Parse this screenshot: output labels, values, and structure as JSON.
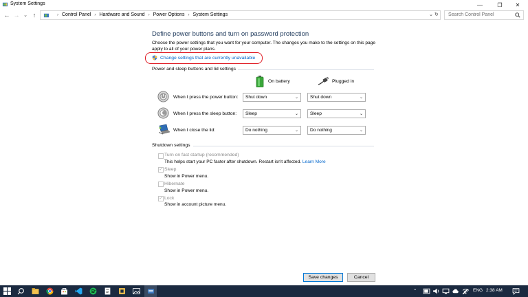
{
  "window": {
    "title": "System Settings",
    "minimize_glyph": "—",
    "restore_glyph": "❐",
    "close_glyph": "✕"
  },
  "nav": {
    "back_glyph": "←",
    "forward_glyph": "→",
    "recent_glyph": "⌄",
    "up_glyph": "↑",
    "breadcrumbs": [
      "Control Panel",
      "Hardware and Sound",
      "Power Options",
      "System Settings"
    ],
    "breadcrumb_separator": "›",
    "dropdown_glyph": "⌄",
    "refresh_glyph": "↻",
    "search_placeholder": "Search Control Panel"
  },
  "page": {
    "heading": "Define power buttons and turn on password protection",
    "description": "Choose the power settings that you want for your computer. The changes you make to the settings on this page apply to all of your power plans.",
    "change_link": "Change settings that are currently unavailable"
  },
  "power_section": {
    "title": "Power and sleep buttons and lid settings",
    "col_battery": "On battery",
    "col_plugged": "Plugged in",
    "rows": [
      {
        "label": "When I press the power button:",
        "battery": "Shut down",
        "plugged": "Shut down"
      },
      {
        "label": "When I press the sleep button:",
        "battery": "Sleep",
        "plugged": "Sleep"
      },
      {
        "label": "When I close the lid:",
        "battery": "Do nothing",
        "plugged": "Do nothing"
      }
    ],
    "caret": "⌄"
  },
  "shutdown_section": {
    "title": "Shutdown settings",
    "items": [
      {
        "label": "Turn on fast startup (recommended)",
        "checked": false,
        "sub": "This helps start your PC faster after shutdown. Restart isn't affected.",
        "link": "Learn More"
      },
      {
        "label": "Sleep",
        "checked": true,
        "sub": "Show in Power menu."
      },
      {
        "label": "Hibernate",
        "checked": false,
        "sub": "Show in Power menu."
      },
      {
        "label": "Lock",
        "checked": true,
        "sub": "Show in account picture menu."
      }
    ],
    "check_glyph": "✓"
  },
  "buttons": {
    "save": "Save changes",
    "cancel": "Cancel"
  },
  "taskbar": {
    "up_chevron": "⌃",
    "language": "ENG",
    "time": "2:38 AM"
  },
  "colors": {
    "heading": "#1e395b",
    "link": "#0066cc",
    "highlight_ring": "#e01b24",
    "taskbar": "#1b2a40"
  }
}
